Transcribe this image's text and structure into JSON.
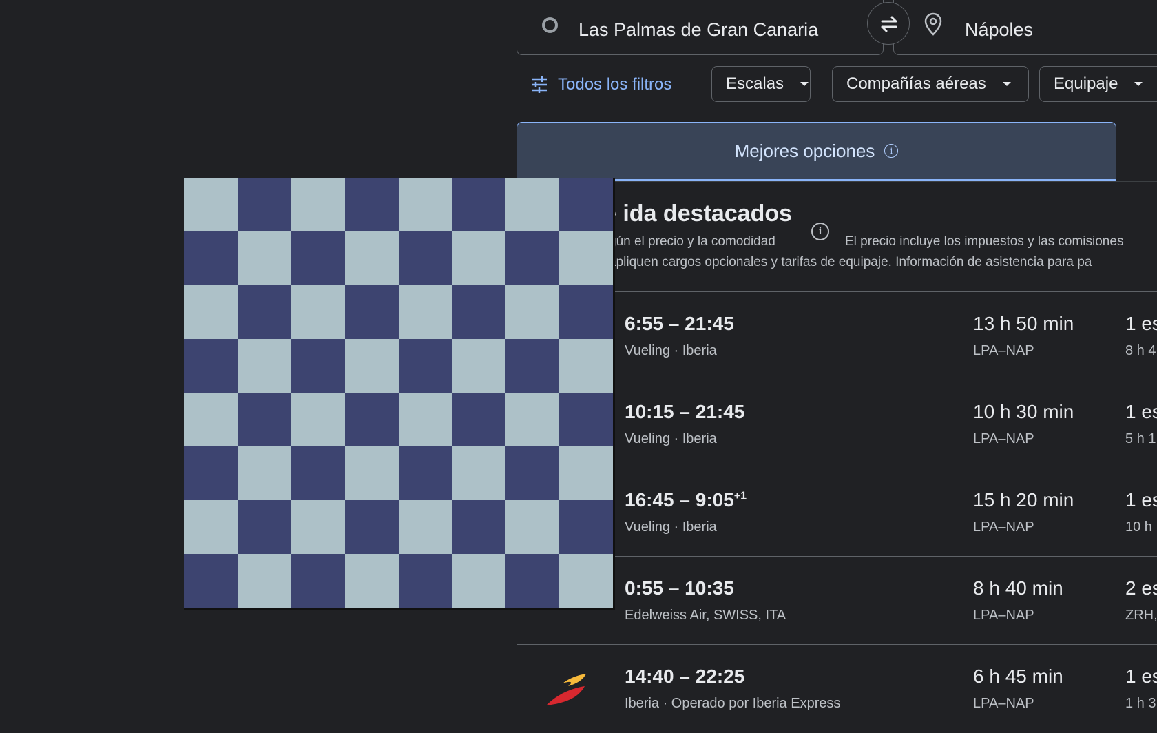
{
  "search": {
    "origin": "Las Palmas de Gran Canaria",
    "destination": "Nápoles"
  },
  "filters": {
    "all_filters_label": "Todos los filtros",
    "chips": [
      "Escalas",
      "Compañías aéreas",
      "Equipaje"
    ]
  },
  "tabs": {
    "best_label": "Mejores opciones"
  },
  "section": {
    "title": "e ida destacados",
    "subtitle_left": "gún el precio y la comodidad",
    "subtitle_right": "El precio incluye los impuestos y las comisiones",
    "note_prefix": "apliquen cargos opcionales y ",
    "note_link1": "tarifas de equipaje",
    "note_mid": ". Información de ",
    "note_link2": "asistencia para pa"
  },
  "flights": [
    {
      "time": "6:55 – 21:45",
      "plus": "",
      "airline": "Vueling · Iberia",
      "duration": "13 h 50 min",
      "route": "LPA–NAP",
      "stops": "1 es",
      "stop_info": "8 h 4"
    },
    {
      "time": "10:15 – 21:45",
      "plus": "",
      "airline": "Vueling · Iberia",
      "duration": "10 h 30 min",
      "route": "LPA–NAP",
      "stops": "1 es",
      "stop_info": "5 h 1"
    },
    {
      "time": "16:45 – 9:05",
      "plus": "+1",
      "airline": "Vueling · Iberia",
      "duration": "15 h 20 min",
      "route": "LPA–NAP",
      "stops": "1 es",
      "stop_info": "10 h"
    },
    {
      "time": "0:55 – 10:35",
      "plus": "",
      "airline": "Edelweiss Air, SWISS, ITA",
      "duration": "8 h 40 min",
      "route": "LPA–NAP",
      "stops": "2 es",
      "stop_info": "ZRH,"
    },
    {
      "time": "14:40 – 22:25",
      "plus": "",
      "airline": "Iberia · Operado por Iberia Express",
      "duration": "6 h 45 min",
      "route": "LPA–NAP",
      "stops": "1 es",
      "stop_info": "1 h 3"
    }
  ],
  "overlay": {
    "colors": {
      "light": "#adc1c8",
      "dark": "#3d4470"
    }
  }
}
